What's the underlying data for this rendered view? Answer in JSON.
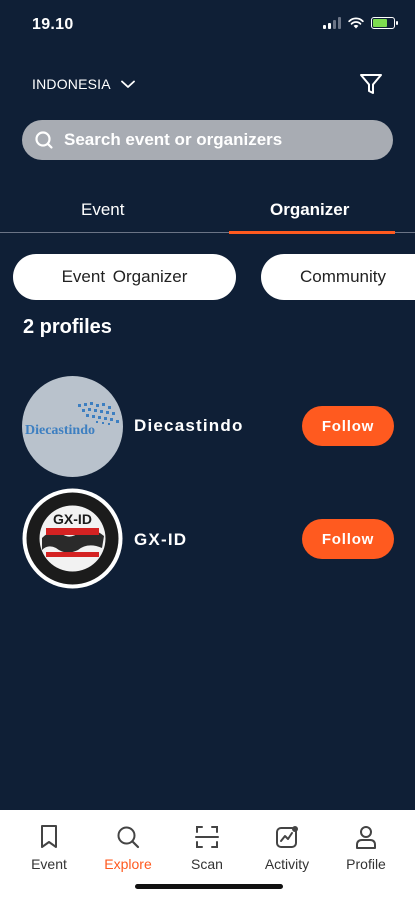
{
  "status_bar": {
    "time": "19.10"
  },
  "header": {
    "region": "INDONESIA"
  },
  "search": {
    "placeholder": "Search event or organizers"
  },
  "tabs": [
    {
      "label": "Event",
      "active": false
    },
    {
      "label": "Organizer",
      "active": true
    }
  ],
  "chips": [
    {
      "label": "Event  Organizer"
    },
    {
      "label": "Community"
    }
  ],
  "results": {
    "count_label": "2 profiles",
    "profiles": [
      {
        "name": "Diecastindo",
        "logo_text": "Diecastindo",
        "follow_label": "Follow"
      },
      {
        "name": "GX-ID",
        "logo_text": "GX-ID",
        "follow_label": "Follow"
      }
    ]
  },
  "bottom_nav": [
    {
      "label": "Event",
      "icon": "bookmark-icon",
      "active": false
    },
    {
      "label": "Explore",
      "icon": "search-icon",
      "active": true
    },
    {
      "label": "Scan",
      "icon": "scan-icon",
      "active": false
    },
    {
      "label": "Activity",
      "icon": "activity-icon",
      "active": false
    },
    {
      "label": "Profile",
      "icon": "user-icon",
      "active": false
    }
  ],
  "colors": {
    "background": "#0f1f36",
    "accent": "#ff5a1f",
    "search_bg": "#a8acb3",
    "nav_bg": "#ffffff"
  }
}
